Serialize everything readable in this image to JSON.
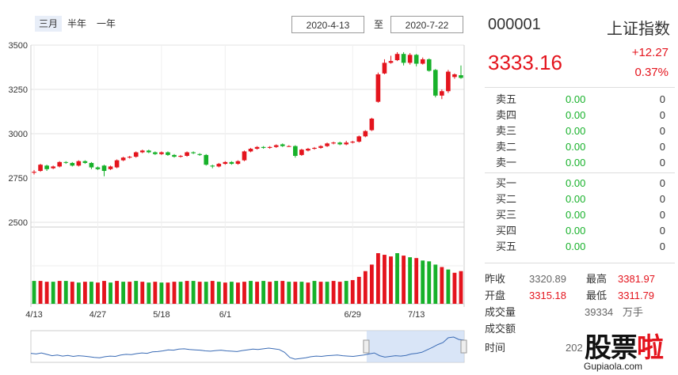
{
  "range_buttons": [
    {
      "label": "三月",
      "active": true
    },
    {
      "label": "半年",
      "active": false
    },
    {
      "label": "一年",
      "active": false
    }
  ],
  "date_from": "2020-4-13",
  "date_to_label": "至",
  "date_to": "2020-7-22",
  "quote": {
    "code": "000001",
    "name": "上证指数",
    "price": "3333.16",
    "change": "+12.27",
    "change_pct": "0.37%"
  },
  "order_book": {
    "asks": [
      {
        "label": "卖五",
        "price": "0.00",
        "volume": "0"
      },
      {
        "label": "卖四",
        "price": "0.00",
        "volume": "0"
      },
      {
        "label": "卖三",
        "price": "0.00",
        "volume": "0"
      },
      {
        "label": "卖二",
        "price": "0.00",
        "volume": "0"
      },
      {
        "label": "卖一",
        "price": "0.00",
        "volume": "0"
      }
    ],
    "bids": [
      {
        "label": "买一",
        "price": "0.00",
        "volume": "0"
      },
      {
        "label": "买二",
        "price": "0.00",
        "volume": "0"
      },
      {
        "label": "买三",
        "price": "0.00",
        "volume": "0"
      },
      {
        "label": "买四",
        "price": "0.00",
        "volume": "0"
      },
      {
        "label": "买五",
        "price": "0.00",
        "volume": "0"
      }
    ]
  },
  "stats": {
    "prev_close_label": "昨收",
    "prev_close": "3320.89",
    "high_label": "最高",
    "high": "3381.97",
    "open_label": "开盘",
    "open": "3315.18",
    "low_label": "最低",
    "low": "3311.79",
    "volume_label": "成交量",
    "volume": "39334",
    "volume_unit": "万手",
    "amount_label": "成交额",
    "time_label": "时间",
    "time": "202"
  },
  "watermark": {
    "text_a": "股票",
    "text_b": "啦",
    "url": "Gupiaola.com"
  },
  "colors": {
    "up": "#e4141d",
    "down": "#17b12a",
    "nav_line": "#3a6bb5",
    "nav_fill": "#c9daf3"
  },
  "chart_data": {
    "type": "candlestick",
    "y_ticks": [
      2500,
      2750,
      3000,
      3250,
      3500
    ],
    "ylim": [
      2500,
      3500
    ],
    "x_tick_labels": [
      "4/13",
      "4/27",
      "5/18",
      "6/1",
      "6/29",
      "7/13"
    ],
    "x_tick_index": [
      0,
      10,
      20,
      30,
      50,
      60
    ],
    "candles": [
      {
        "o": 2780,
        "c": 2785,
        "h": 2795,
        "l": 2770
      },
      {
        "o": 2790,
        "c": 2825,
        "h": 2830,
        "l": 2785
      },
      {
        "o": 2820,
        "c": 2800,
        "h": 2825,
        "l": 2790
      },
      {
        "o": 2805,
        "c": 2815,
        "h": 2820,
        "l": 2800
      },
      {
        "o": 2815,
        "c": 2840,
        "h": 2845,
        "l": 2810
      },
      {
        "o": 2840,
        "c": 2838,
        "h": 2845,
        "l": 2830
      },
      {
        "o": 2835,
        "c": 2820,
        "h": 2840,
        "l": 2815
      },
      {
        "o": 2820,
        "c": 2845,
        "h": 2850,
        "l": 2815
      },
      {
        "o": 2845,
        "c": 2835,
        "h": 2850,
        "l": 2830
      },
      {
        "o": 2835,
        "c": 2810,
        "h": 2840,
        "l": 2800
      },
      {
        "o": 2810,
        "c": 2800,
        "h": 2815,
        "l": 2795
      },
      {
        "o": 2820,
        "c": 2790,
        "h": 2825,
        "l": 2760
      },
      {
        "o": 2800,
        "c": 2815,
        "h": 2820,
        "l": 2795
      },
      {
        "o": 2810,
        "c": 2850,
        "h": 2855,
        "l": 2805
      },
      {
        "o": 2850,
        "c": 2865,
        "h": 2870,
        "l": 2845
      },
      {
        "o": 2865,
        "c": 2870,
        "h": 2875,
        "l": 2860
      },
      {
        "o": 2870,
        "c": 2895,
        "h": 2900,
        "l": 2865
      },
      {
        "o": 2895,
        "c": 2905,
        "h": 2910,
        "l": 2890
      },
      {
        "o": 2905,
        "c": 2895,
        "h": 2910,
        "l": 2890
      },
      {
        "o": 2895,
        "c": 2885,
        "h": 2900,
        "l": 2880
      },
      {
        "o": 2885,
        "c": 2895,
        "h": 2900,
        "l": 2880
      },
      {
        "o": 2895,
        "c": 2880,
        "h": 2900,
        "l": 2875
      },
      {
        "o": 2880,
        "c": 2870,
        "h": 2885,
        "l": 2865
      },
      {
        "o": 2870,
        "c": 2875,
        "h": 2880,
        "l": 2865
      },
      {
        "o": 2875,
        "c": 2895,
        "h": 2900,
        "l": 2870
      },
      {
        "o": 2895,
        "c": 2890,
        "h": 2900,
        "l": 2885
      },
      {
        "o": 2885,
        "c": 2880,
        "h": 2890,
        "l": 2875
      },
      {
        "o": 2880,
        "c": 2825,
        "h": 2885,
        "l": 2820
      },
      {
        "o": 2820,
        "c": 2815,
        "h": 2825,
        "l": 2805
      },
      {
        "o": 2815,
        "c": 2830,
        "h": 2835,
        "l": 2810
      },
      {
        "o": 2830,
        "c": 2840,
        "h": 2845,
        "l": 2825
      },
      {
        "o": 2840,
        "c": 2830,
        "h": 2845,
        "l": 2825
      },
      {
        "o": 2830,
        "c": 2845,
        "h": 2850,
        "l": 2825
      },
      {
        "o": 2850,
        "c": 2900,
        "h": 2905,
        "l": 2845
      },
      {
        "o": 2900,
        "c": 2915,
        "h": 2920,
        "l": 2895
      },
      {
        "o": 2915,
        "c": 2925,
        "h": 2930,
        "l": 2910
      },
      {
        "o": 2925,
        "c": 2920,
        "h": 2930,
        "l": 2915
      },
      {
        "o": 2920,
        "c": 2925,
        "h": 2930,
        "l": 2915
      },
      {
        "o": 2925,
        "c": 2935,
        "h": 2940,
        "l": 2920
      },
      {
        "o": 2940,
        "c": 2930,
        "h": 2945,
        "l": 2925
      },
      {
        "o": 2930,
        "c": 2930,
        "h": 2935,
        "l": 2925
      },
      {
        "o": 2930,
        "c": 2875,
        "h": 2935,
        "l": 2865
      },
      {
        "o": 2880,
        "c": 2910,
        "h": 2915,
        "l": 2875
      },
      {
        "o": 2905,
        "c": 2915,
        "h": 2920,
        "l": 2900
      },
      {
        "o": 2915,
        "c": 2920,
        "h": 2925,
        "l": 2910
      },
      {
        "o": 2920,
        "c": 2930,
        "h": 2935,
        "l": 2915
      },
      {
        "o": 2930,
        "c": 2945,
        "h": 2950,
        "l": 2925
      },
      {
        "o": 2945,
        "c": 2950,
        "h": 2955,
        "l": 2940
      },
      {
        "o": 2950,
        "c": 2940,
        "h": 2955,
        "l": 2935
      },
      {
        "o": 2940,
        "c": 2950,
        "h": 2960,
        "l": 2935
      },
      {
        "o": 2950,
        "c": 2955,
        "h": 2960,
        "l": 2945
      },
      {
        "o": 2955,
        "c": 2985,
        "h": 2990,
        "l": 2950
      },
      {
        "o": 2985,
        "c": 3015,
        "h": 3020,
        "l": 2980
      },
      {
        "o": 3020,
        "c": 3085,
        "h": 3090,
        "l": 3015
      },
      {
        "o": 3180,
        "c": 3335,
        "h": 3345,
        "l": 3175
      },
      {
        "o": 3340,
        "c": 3400,
        "h": 3420,
        "l": 3335
      },
      {
        "o": 3400,
        "c": 3410,
        "h": 3440,
        "l": 3395
      },
      {
        "o": 3415,
        "c": 3450,
        "h": 3460,
        "l": 3410
      },
      {
        "o": 3450,
        "c": 3400,
        "h": 3460,
        "l": 3385
      },
      {
        "o": 3400,
        "c": 3445,
        "h": 3455,
        "l": 3390
      },
      {
        "o": 3445,
        "c": 3395,
        "h": 3450,
        "l": 3380
      },
      {
        "o": 3395,
        "c": 3420,
        "h": 3430,
        "l": 3390
      },
      {
        "o": 3420,
        "c": 3355,
        "h": 3425,
        "l": 3350
      },
      {
        "o": 3360,
        "c": 3215,
        "h": 3365,
        "l": 3205
      },
      {
        "o": 3215,
        "c": 3240,
        "h": 3250,
        "l": 3195
      },
      {
        "o": 3240,
        "c": 3350,
        "h": 3360,
        "l": 3230
      },
      {
        "o": 3320,
        "c": 3335,
        "h": 3340,
        "l": 3310
      },
      {
        "o": 3330,
        "c": 3315,
        "h": 3385,
        "l": 3310
      }
    ],
    "volume": {
      "values": [
        28,
        28,
        27,
        27,
        28,
        28,
        27,
        26,
        27,
        27,
        26,
        28,
        26,
        28,
        27,
        27,
        28,
        27,
        26,
        27,
        26,
        26,
        27,
        27,
        28,
        28,
        27,
        27,
        28,
        27,
        26,
        27,
        26,
        27,
        28,
        27,
        28,
        27,
        28,
        28,
        27,
        27,
        27,
        26,
        28,
        27,
        27,
        28,
        27,
        28,
        29,
        33,
        40,
        48,
        62,
        60,
        58,
        62,
        59,
        57,
        56,
        53,
        52,
        48,
        45,
        42,
        38,
        40
      ],
      "up_flags": [
        0,
        1,
        1,
        0,
        1,
        0,
        1,
        0,
        1,
        0,
        1,
        1,
        0,
        1,
        0,
        1,
        0,
        1,
        0,
        1,
        0,
        1,
        1,
        0,
        1,
        0,
        1,
        0,
        1,
        0,
        1,
        0,
        1,
        1,
        0,
        1,
        0,
        1,
        0,
        1,
        0,
        1,
        0,
        1,
        0,
        1,
        0,
        1,
        1,
        0,
        1,
        1,
        1,
        1,
        1,
        1,
        1,
        0,
        1,
        0,
        1,
        0,
        0,
        0,
        1,
        0,
        1,
        1
      ]
    },
    "navigator": {
      "values": [
        2950,
        2930,
        2960,
        2920,
        2880,
        2900,
        2870,
        2890,
        2860,
        2880,
        2870,
        2850,
        2830,
        2820,
        2850,
        2870,
        2860,
        2900,
        2920,
        2910,
        2940,
        2960,
        2950,
        2990,
        3000,
        3020,
        3050,
        3040,
        3070,
        3080,
        3060,
        3050,
        3040,
        3020,
        3010,
        3030,
        3040,
        3020,
        3010,
        3000,
        3030,
        3050,
        3070,
        3060,
        3080,
        3100,
        3080,
        3060,
        2980,
        2830,
        2780,
        2800,
        2820,
        2850,
        2870,
        2860,
        2880,
        2890,
        2900,
        2880,
        2870,
        2860,
        2880,
        2900,
        2930,
        2960,
        2880,
        2840,
        2860,
        2880,
        2870,
        2890,
        2930,
        2950,
        2980,
        3050,
        3120,
        3200,
        3260,
        3400,
        3420,
        3350,
        3330
      ]
    }
  }
}
